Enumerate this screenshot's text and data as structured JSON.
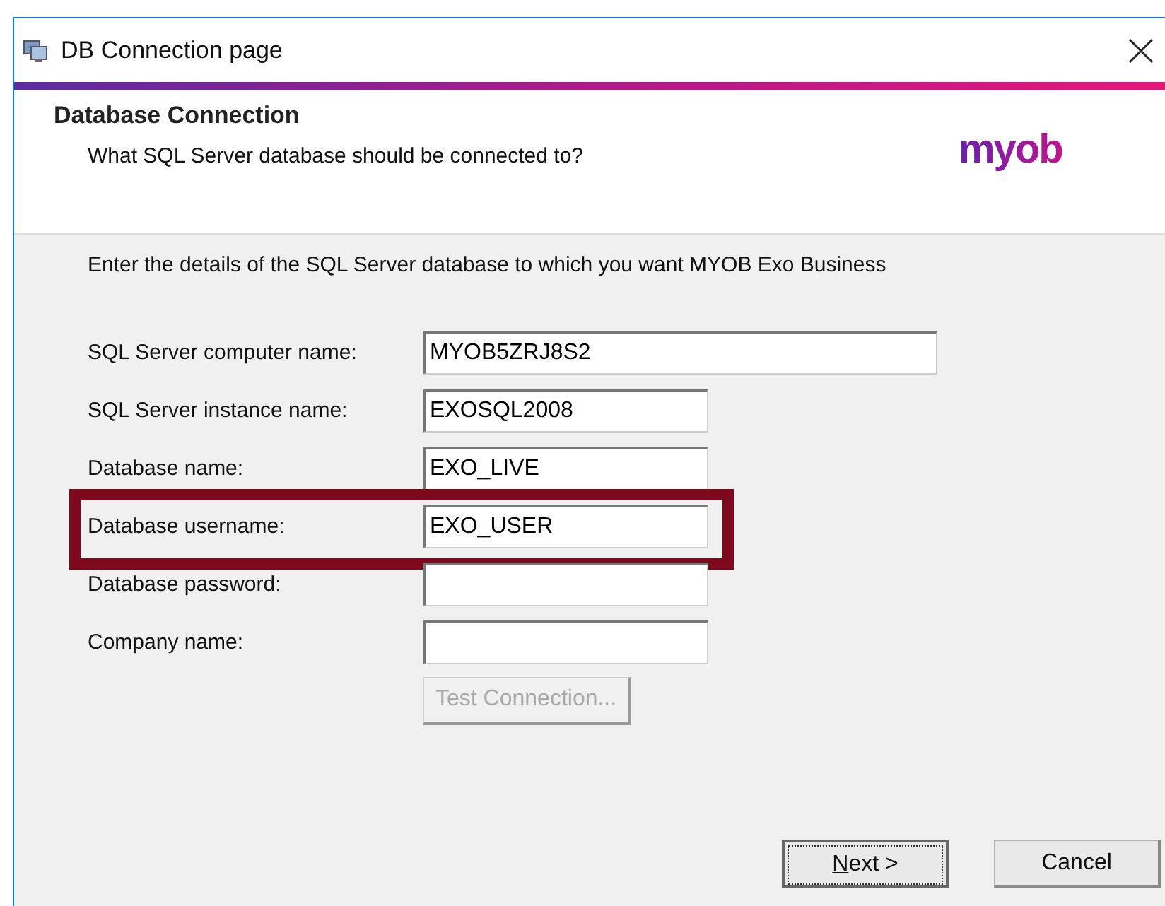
{
  "window": {
    "title": "DB Connection page"
  },
  "header": {
    "title": "Database Connection",
    "subtitle": "What SQL Server database should be connected to?",
    "logo": "myob"
  },
  "intro": "Enter the details of the SQL Server database to which you want MYOB Exo Business",
  "fields": [
    {
      "label": "SQL Server computer name:",
      "value": "MYOB5ZRJ8S2",
      "kind": "wide",
      "highlighted": false
    },
    {
      "label": "SQL Server instance name:",
      "value": "EXOSQL2008",
      "kind": "normal",
      "highlighted": false
    },
    {
      "label": "Database name:",
      "value": "EXO_LIVE",
      "kind": "normal",
      "highlighted": false
    },
    {
      "label": "Database username:",
      "value": "EXO_USER",
      "kind": "normal",
      "highlighted": true
    },
    {
      "label": "Database password:",
      "kind": "normal",
      "highlighted": false
    },
    {
      "label": "Company name:",
      "kind": "normal",
      "highlighted": false
    }
  ],
  "test_button": {
    "label": "Test Connection...",
    "disabled": true
  },
  "buttons": [
    {
      "label": "Next >",
      "default": true
    },
    {
      "label": "Cancel",
      "default": false
    }
  ]
}
